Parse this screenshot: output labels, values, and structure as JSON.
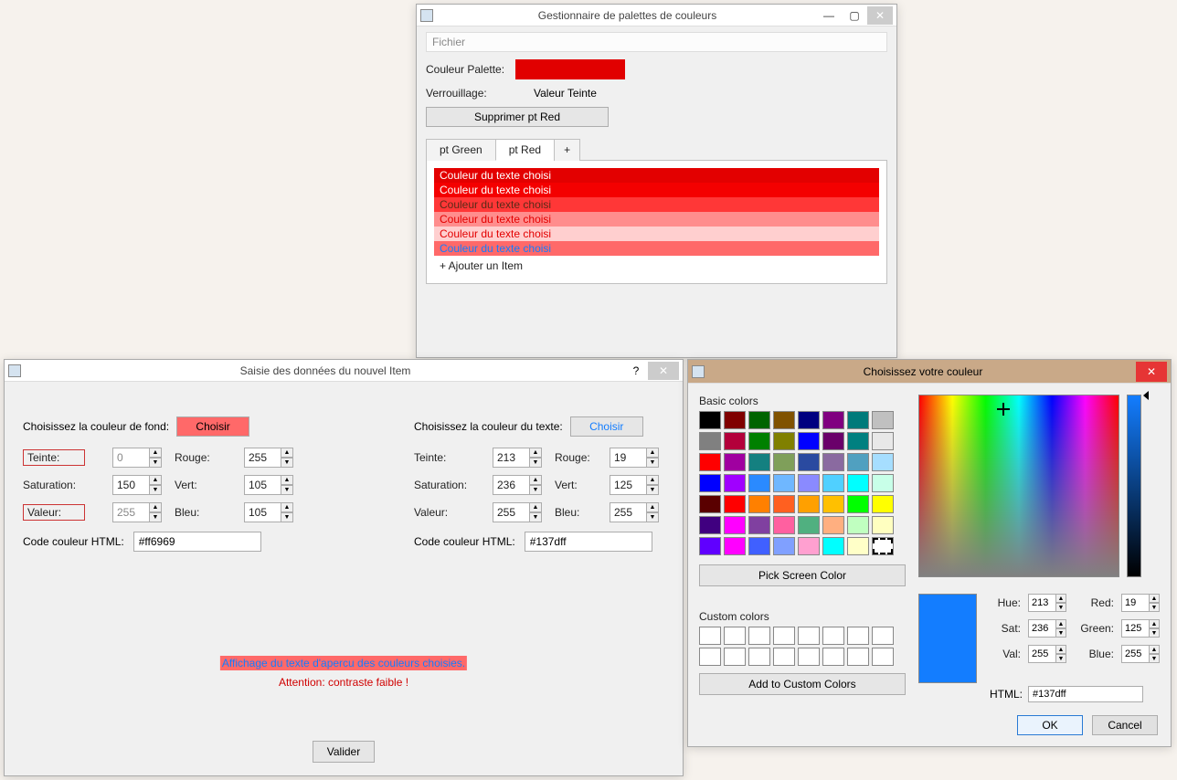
{
  "palette_mgr": {
    "title": "Gestionnaire de palettes de couleurs",
    "menu_file": "Fichier",
    "lbl_couleur_palette": "Couleur Palette:",
    "lbl_verrouillage": "Verrouillage:",
    "val_verrouillage": "Valeur Teinte",
    "btn_supprimer": "Supprimer pt Red",
    "tabs": {
      "green": "pt Green",
      "red": "pt Red",
      "plus": "+"
    },
    "rows": [
      {
        "label": "Couleur du texte choisi",
        "bg": "#e30000",
        "fg": "#ffffff"
      },
      {
        "label": "Couleur du texte choisi",
        "bg": "#f40000",
        "fg": "#ffffff"
      },
      {
        "label": "Couleur du texte choisi",
        "bg": "#ff3737",
        "fg": "#5a2a18"
      },
      {
        "label": "Couleur du texte choisi",
        "bg": "#ff8d8d",
        "fg": "#e30000"
      },
      {
        "label": "Couleur du texte choisi",
        "bg": "#ffcfcf",
        "fg": "#e30000"
      },
      {
        "label": "Couleur du texte choisi",
        "bg": "#ff6969",
        "fg": "#137dff"
      }
    ],
    "add_item": "+ Ajouter un Item"
  },
  "item_entry": {
    "title": "Saisie des données du nouvel Item",
    "lbl_choose_bg": "Choisissez la couleur de fond:",
    "lbl_choose_fg": "Choisissez la couleur du texte:",
    "btn_choose": "Choisir",
    "lbl_teinte": "Teinte:",
    "lbl_saturation": "Saturation:",
    "lbl_valeur": "Valeur:",
    "lbl_rouge": "Rouge:",
    "lbl_vert": "Vert:",
    "lbl_bleu": "Bleu:",
    "lbl_html": "Code couleur HTML:",
    "bg": {
      "teinte": "0",
      "saturation": "150",
      "valeur": "255",
      "rouge": "255",
      "vert": "105",
      "bleu": "105",
      "html": "#ff6969"
    },
    "fg": {
      "teinte": "213",
      "saturation": "236",
      "valeur": "255",
      "rouge": "19",
      "vert": "125",
      "bleu": "255",
      "html": "#137dff"
    },
    "preview_text": "Affichage du texte d'apercu des couleurs choisies.",
    "warn_text": "Attention: contraste faible !",
    "btn_validate": "Valider"
  },
  "color_picker": {
    "title": "Choisissez votre couleur",
    "lbl_basic": "Basic colors",
    "basic_colors": [
      "#000000",
      "#800000",
      "#006400",
      "#805200",
      "#000080",
      "#800080",
      "#007a7a",
      "#c0c0c0",
      "#808080",
      "#b3003b",
      "#008000",
      "#808000",
      "#0000ff",
      "#6a006a",
      "#008080",
      "#e8e8e8",
      "#ff0000",
      "#a000a0",
      "#148080",
      "#7f9f5a",
      "#2a4aa0",
      "#8a6aa0",
      "#50a0c0",
      "#a6deff",
      "#0000ff",
      "#a000ff",
      "#2a8aff",
      "#6fb7ff",
      "#8a8aff",
      "#50d0ff",
      "#00ffff",
      "#c8ffe8",
      "#5a0000",
      "#ff0000",
      "#ff8000",
      "#ff6020",
      "#ffa000",
      "#ffc000",
      "#00ff00",
      "#ffff00",
      "#400080",
      "#ff00ff",
      "#8040a0",
      "#ff60a0",
      "#50b080",
      "#ffaf80",
      "#c0ffc0",
      "#ffffc0",
      "#6000ff",
      "#ff00ff",
      "#4060ff",
      "#80a0ff",
      "#ffa0d0",
      "#00ffff",
      "#ffffc8",
      "#ffffff"
    ],
    "btn_pick": "Pick Screen Color",
    "lbl_custom": "Custom colors",
    "btn_add_custom": "Add to Custom Colors",
    "lbl_hue": "Hue:",
    "lbl_sat": "Sat:",
    "lbl_val": "Val:",
    "lbl_red": "Red:",
    "lbl_green": "Green:",
    "lbl_blue": "Blue:",
    "lbl_html": "HTML:",
    "vals": {
      "hue": "213",
      "sat": "236",
      "val": "255",
      "red": "19",
      "green": "125",
      "blue": "255",
      "html": "#137dff"
    },
    "btn_ok": "OK",
    "btn_cancel": "Cancel"
  }
}
